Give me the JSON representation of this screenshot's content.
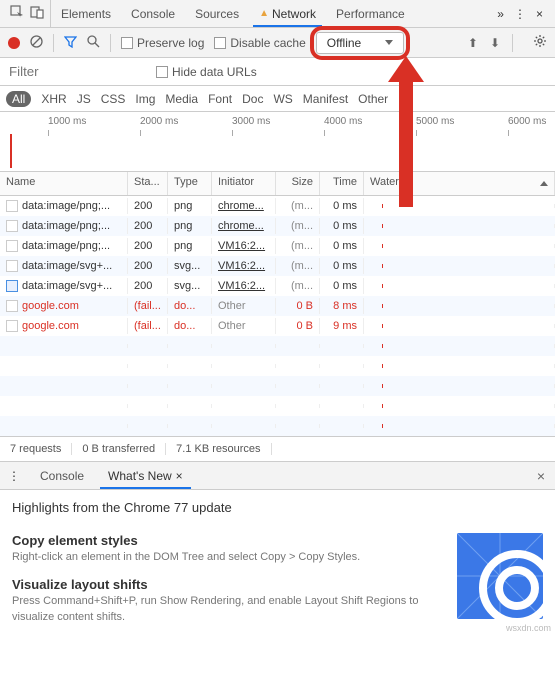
{
  "tabs": {
    "items": [
      "Elements",
      "Console",
      "Sources",
      "Network",
      "Performance"
    ],
    "active": "Network",
    "more": "»",
    "close": "×"
  },
  "toolbar": {
    "preserve_log": "Preserve log",
    "disable_cache": "Disable cache",
    "throttle_value": "Offline",
    "upload": "⬆",
    "download": "⬇"
  },
  "filter": {
    "placeholder": "Filter",
    "hide_data_urls": "Hide data URLs"
  },
  "types": [
    "All",
    "XHR",
    "JS",
    "CSS",
    "Img",
    "Media",
    "Font",
    "Doc",
    "WS",
    "Manifest",
    "Other"
  ],
  "timeline": {
    "ticks": [
      "1000 ms",
      "2000 ms",
      "3000 ms",
      "4000 ms",
      "5000 ms",
      "6000 ms"
    ]
  },
  "table": {
    "headers": {
      "name": "Name",
      "status": "Sta...",
      "type": "Type",
      "initiator": "Initiator",
      "size": "Size",
      "time": "Time",
      "waterfall": "Waterfall"
    },
    "rows": [
      {
        "name": "data:image/png;...",
        "status": "200",
        "type": "png",
        "init": "chrome...",
        "init_gray": false,
        "size": "(m...",
        "time": "0 ms",
        "failed": false
      },
      {
        "name": "data:image/png;...",
        "status": "200",
        "type": "png",
        "init": "chrome...",
        "init_gray": false,
        "size": "(m...",
        "time": "0 ms",
        "failed": false
      },
      {
        "name": "data:image/png;...",
        "status": "200",
        "type": "png",
        "init": "VM16:2...",
        "init_gray": false,
        "size": "(m...",
        "time": "0 ms",
        "failed": false
      },
      {
        "name": "data:image/svg+...",
        "status": "200",
        "type": "svg...",
        "init": "VM16:2...",
        "init_gray": false,
        "size": "(m...",
        "time": "0 ms",
        "failed": false
      },
      {
        "name": "data:image/svg+...",
        "status": "200",
        "type": "svg...",
        "init": "VM16:2...",
        "init_gray": false,
        "size": "(m...",
        "time": "0 ms",
        "failed": false
      },
      {
        "name": "google.com",
        "status": "(fail...",
        "type": "do...",
        "init": "Other",
        "init_gray": true,
        "size": "0 B",
        "time": "8 ms",
        "failed": true
      },
      {
        "name": "google.com",
        "status": "(fail...",
        "type": "do...",
        "init": "Other",
        "init_gray": true,
        "size": "0 B",
        "time": "9 ms",
        "failed": true
      }
    ]
  },
  "summary": {
    "requests": "7 requests",
    "transferred": "0 B transferred",
    "resources": "7.1 KB resources"
  },
  "drawer": {
    "tabs": [
      "Console",
      "What's New"
    ],
    "active": "What's New",
    "title": "Highlights from the Chrome 77 update",
    "items": [
      {
        "title": "Copy element styles",
        "desc": "Right-click an element in the DOM Tree and select Copy > Copy Styles."
      },
      {
        "title": "Visualize layout shifts",
        "desc": "Press Command+Shift+P, run Show Rendering, and enable Layout Shift Regions to visualize content shifts."
      }
    ]
  },
  "watermark": "wsxdn.com"
}
